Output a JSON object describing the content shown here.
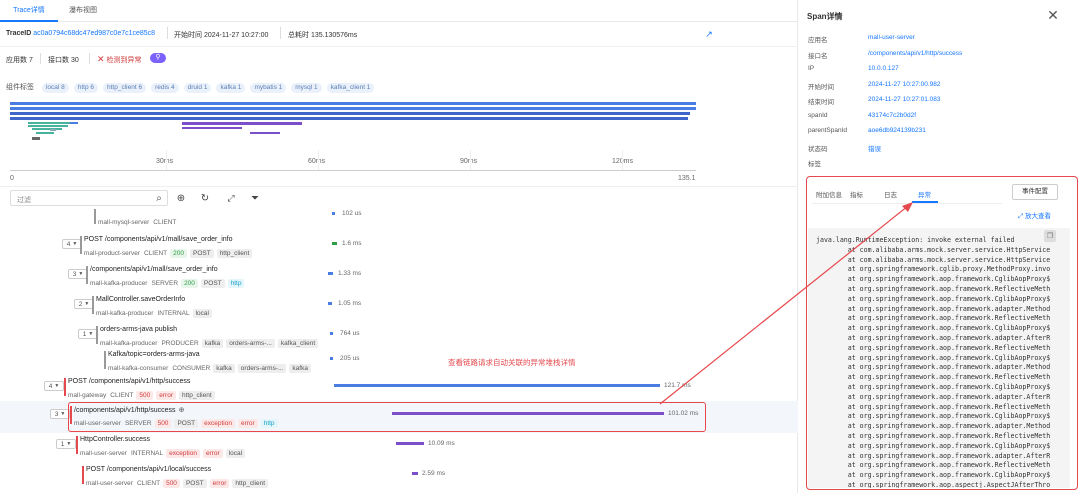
{
  "tabs": [
    "Trace详情",
    "瀑布视图"
  ],
  "trace_bar": {
    "trace_label": "TraceID",
    "trace_id": "ac0a0794c68dc47ed987c0e7c1ce85c8",
    "start_label": "开始时间",
    "start_time": "2024-11-27 10:27:00",
    "duration_label": "总耗时",
    "duration": "135.130576ms"
  },
  "counts": {
    "app_label": "应用数",
    "app_count": "7",
    "iface_label": "接口数",
    "iface_count": "30",
    "detect_label": "检测到异常"
  },
  "component_tags": {
    "label": "组件标签",
    "items": [
      "local 8",
      "http 6",
      "http_client 6",
      "redis 4",
      "druid 1",
      "kafka 1",
      "mybatis 1",
      "mysql 1",
      "kafka_client 1"
    ]
  },
  "timeline": {
    "ticks": [
      "30ms",
      "60ms",
      "90ms",
      "120ms"
    ],
    "min": "0",
    "max": "135.1"
  },
  "toolbar": {
    "filter_placeholder": "过滤"
  },
  "spans": [
    {
      "toggle": "",
      "name": "",
      "service": "mall-mysql-server",
      "kind": "CLIENT",
      "tags": [],
      "duration": "102 us",
      "bar_start": 0.0,
      "bar_width": 0.0
    },
    {
      "toggle": "4",
      "name": "POST /components/api/v1/mall/save_order_info",
      "service": "mall-product-server",
      "kind": "CLIENT",
      "tags": [
        [
          "200",
          "green"
        ],
        [
          "POST",
          "grey"
        ],
        [
          "http_client",
          "grey"
        ]
      ],
      "duration": "1.6 ms",
      "bar_start": 0.0,
      "bar_width": 0.012
    },
    {
      "toggle": "3",
      "name": "/components/api/v1/mall/save_order_info",
      "service": "mall-kafka-producer",
      "kind": "SERVER",
      "tags": [
        [
          "200",
          "green"
        ],
        [
          "POST",
          "grey"
        ],
        [
          "http",
          "cyan"
        ]
      ],
      "duration": "1.33 ms",
      "bar_start": 0.0,
      "bar_width": 0.01
    },
    {
      "toggle": "2",
      "name": "MallController.saveOrderInfo",
      "service": "mall-kafka-producer",
      "kind": "INTERNAL",
      "tags": [
        [
          "local",
          "grey"
        ]
      ],
      "duration": "1.05 ms",
      "bar_start": 0.0,
      "bar_width": 0.008
    },
    {
      "toggle": "1",
      "name": "orders-arms-java publish",
      "service": "mall-kafka-producer",
      "kind": "PRODUCER",
      "tags": [
        [
          "kafka",
          "grey"
        ],
        [
          "orders-arms-...",
          "grey"
        ],
        [
          "kafka_client",
          "grey"
        ]
      ],
      "duration": "764 us",
      "bar_start": 0.0,
      "bar_width": 0.006
    },
    {
      "toggle": "",
      "name": "Kafka/topic=orders-arms-java",
      "service": "mall-kafka-consumer",
      "kind": "CONSUMER",
      "tags": [
        [
          "kafka",
          "grey"
        ],
        [
          "orders-arms-...",
          "grey"
        ],
        [
          "kafka",
          "grey"
        ]
      ],
      "duration": "205 us",
      "bar_start": 0.0,
      "bar_width": 0.002
    },
    {
      "toggle": "4",
      "name": "POST /components/api/v1/http/success",
      "service": "mall-gateway",
      "kind": "CLIENT",
      "tags": [
        [
          "500",
          "red"
        ],
        [
          "error",
          "red"
        ],
        [
          "http_client",
          "grey"
        ]
      ],
      "duration": "121.7 ms",
      "bar_start": 0.0,
      "bar_width": 0.9
    },
    {
      "toggle": "3",
      "name": "/components/api/v1/http/success",
      "service": "mall-user-server",
      "kind": "SERVER",
      "tags": [
        [
          "500",
          "red"
        ],
        [
          "POST",
          "grey"
        ],
        [
          "exception",
          "red"
        ],
        [
          "error",
          "red"
        ],
        [
          "http",
          "cyan"
        ]
      ],
      "duration": "101.02 ms",
      "bar_start": 0.0,
      "bar_width": 0.75
    },
    {
      "toggle": "1",
      "name": "HttpController.success",
      "service": "mall-user-server",
      "kind": "INTERNAL",
      "tags": [
        [
          "exception",
          "red"
        ],
        [
          "error",
          "red"
        ],
        [
          "local",
          "grey"
        ]
      ],
      "duration": "10.09 ms",
      "bar_start": 0.0,
      "bar_width": 0.075
    },
    {
      "toggle": "",
      "name": "POST /components/api/v1/local/success",
      "service": "mall-user-server",
      "kind": "CLIENT",
      "tags": [
        [
          "500",
          "red"
        ],
        [
          "POST",
          "grey"
        ],
        [
          "error",
          "red"
        ],
        [
          "http_client",
          "grey"
        ]
      ],
      "duration": "2.59 ms",
      "bar_start": 0.0,
      "bar_width": 0.02
    }
  ],
  "annotation": "查看链路请求自动关联的异常堆栈详情",
  "span_detail": {
    "title": "Span详情",
    "fields": [
      {
        "key": "应用名",
        "value": "mall-user-server"
      },
      {
        "key": "接口名",
        "value": "/components/api/v1/http/success"
      },
      {
        "key": "IP",
        "value": "10.0.0.127"
      },
      {
        "key": "开始时间",
        "value": "2024-11-27 10:27:00.982"
      },
      {
        "key": "结束时间",
        "value": "2024-11-27 10:27:01.083"
      },
      {
        "key": "spanId",
        "value": "43174c7c2b0d2f"
      },
      {
        "key": "parentSpanId",
        "value": "aoe6db924139b231"
      },
      {
        "key": "状态码",
        "value": "错误"
      },
      {
        "key": "标签",
        "value": ""
      }
    ],
    "subtabs": [
      "附加信息",
      "指标",
      "日志",
      "异常"
    ],
    "event_config": "事件配置",
    "enlarge": "放大查看",
    "stack": [
      "java.lang.RuntimeException: invoke external failed",
      "        at com.alibaba.arms.mock.server.service.HttpService",
      "        at com.alibaba.arms.mock.server.service.HttpService",
      "        at org.springframework.cglib.proxy.MethodProxy.invo",
      "        at org.springframework.aop.framework.CglibAopProxy$",
      "        at org.springframework.aop.framework.ReflectiveMeth",
      "        at org.springframework.aop.framework.CglibAopProxy$",
      "        at org.springframework.aop.framework.adapter.Method",
      "        at org.springframework.aop.framework.ReflectiveMeth",
      "        at org.springframework.aop.framework.CglibAopProxy$",
      "        at org.springframework.aop.framework.adapter.AfterR",
      "        at org.springframework.aop.framework.ReflectiveMeth",
      "        at org.springframework.aop.framework.CglibAopProxy$",
      "        at org.springframework.aop.framework.adapter.Method",
      "        at org.springframework.aop.framework.ReflectiveMeth",
      "        at org.springframework.aop.framework.CglibAopProxy$",
      "        at org.springframework.aop.framework.adapter.AfterR",
      "        at org.springframework.aop.framework.ReflectiveMeth",
      "        at org.springframework.aop.framework.CglibAopProxy$",
      "        at org.springframework.aop.framework.adapter.Method",
      "        at org.springframework.aop.framework.ReflectiveMeth",
      "        at org.springframework.aop.framework.CglibAopProxy$",
      "        at org.springframework.aop.framework.adapter.AfterR",
      "        at org.springframework.aop.framework.ReflectiveMeth",
      "        at org.springframework.aop.framework.CglibAopProxy$",
      "        at org.springframework.aop.aspectj.AspectJAfterThro"
    ]
  }
}
